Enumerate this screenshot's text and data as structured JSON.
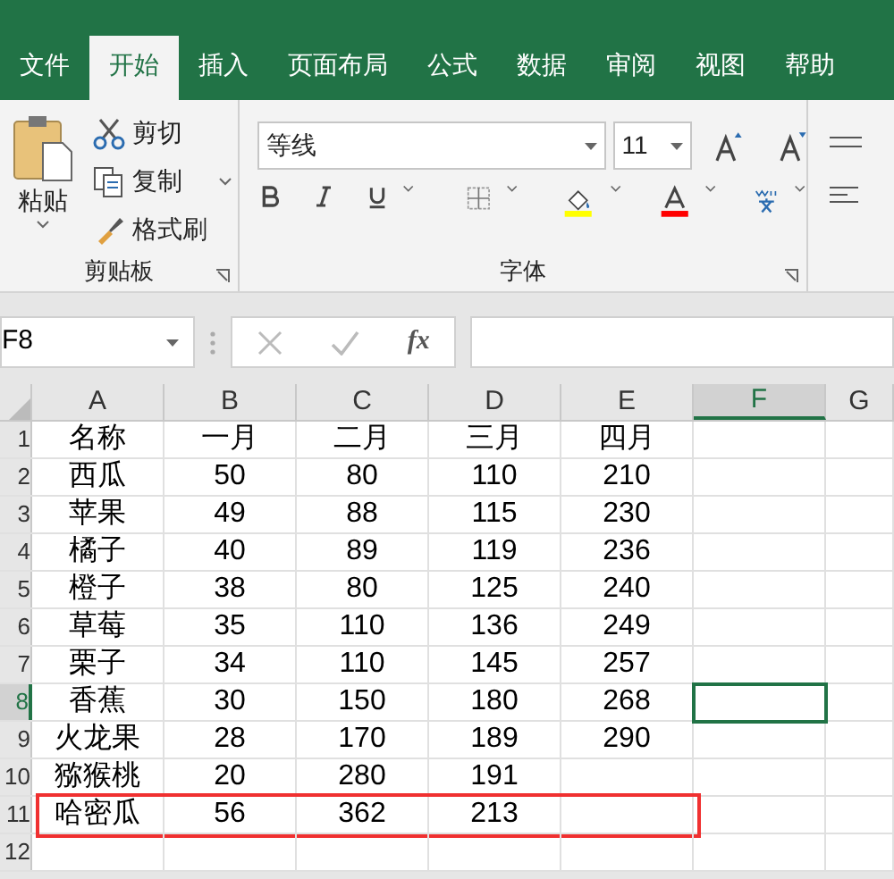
{
  "tabs": [
    {
      "label": "文件",
      "selected": false
    },
    {
      "label": "开始",
      "selected": true
    },
    {
      "label": "插入",
      "selected": false
    },
    {
      "label": "页面布局",
      "selected": false
    },
    {
      "label": "公式",
      "selected": false
    },
    {
      "label": "数据",
      "selected": false
    },
    {
      "label": "审阅",
      "selected": false
    },
    {
      "label": "视图",
      "selected": false
    },
    {
      "label": "帮助",
      "selected": false
    }
  ],
  "clipboard": {
    "paste": "粘贴",
    "cut": "剪切",
    "copy": "复制",
    "format_painter": "格式刷",
    "group_label": "剪贴板"
  },
  "font": {
    "font_name": "等线",
    "font_size": "11",
    "group_label": "字体"
  },
  "formula_bar": {
    "name_box": "F8",
    "fx": "fx"
  },
  "columns": [
    {
      "label": "A",
      "selected": false
    },
    {
      "label": "B",
      "selected": false
    },
    {
      "label": "C",
      "selected": false
    },
    {
      "label": "D",
      "selected": false
    },
    {
      "label": "E",
      "selected": false
    },
    {
      "label": "F",
      "selected": true
    },
    {
      "label": "G",
      "selected": false
    }
  ],
  "rows": [
    {
      "number": "1",
      "selected": false,
      "highlighted": false,
      "cells": [
        "名称",
        "一月",
        "二月",
        "三月",
        "四月"
      ]
    },
    {
      "number": "2",
      "selected": false,
      "highlighted": false,
      "cells": [
        "西瓜",
        "50",
        "80",
        "110",
        "210"
      ]
    },
    {
      "number": "3",
      "selected": false,
      "highlighted": false,
      "cells": [
        "苹果",
        "49",
        "88",
        "115",
        "230"
      ]
    },
    {
      "number": "4",
      "selected": false,
      "highlighted": false,
      "cells": [
        "橘子",
        "40",
        "89",
        "119",
        "236"
      ]
    },
    {
      "number": "5",
      "selected": false,
      "highlighted": false,
      "cells": [
        "橙子",
        "38",
        "80",
        "125",
        "240"
      ]
    },
    {
      "number": "6",
      "selected": false,
      "highlighted": false,
      "cells": [
        "草莓",
        "35",
        "110",
        "136",
        "249"
      ]
    },
    {
      "number": "7",
      "selected": false,
      "highlighted": false,
      "cells": [
        "栗子",
        "34",
        "110",
        "145",
        "257"
      ]
    },
    {
      "number": "8",
      "selected": true,
      "highlighted": false,
      "cells": [
        "香蕉",
        "30",
        "150",
        "180",
        "268"
      ]
    },
    {
      "number": "9",
      "selected": false,
      "highlighted": false,
      "cells": [
        "火龙果",
        "28",
        "170",
        "189",
        "290"
      ]
    },
    {
      "number": "10",
      "selected": false,
      "highlighted": false,
      "cells": [
        "猕猴桃",
        "20",
        "280",
        "191",
        ""
      ]
    },
    {
      "number": "11",
      "selected": false,
      "highlighted": true,
      "cells": [
        "哈密瓜",
        "56",
        "362",
        "213",
        ""
      ]
    },
    {
      "number": "12",
      "selected": false,
      "highlighted": false,
      "cells": [
        "",
        "",
        "",
        "",
        ""
      ]
    }
  ]
}
